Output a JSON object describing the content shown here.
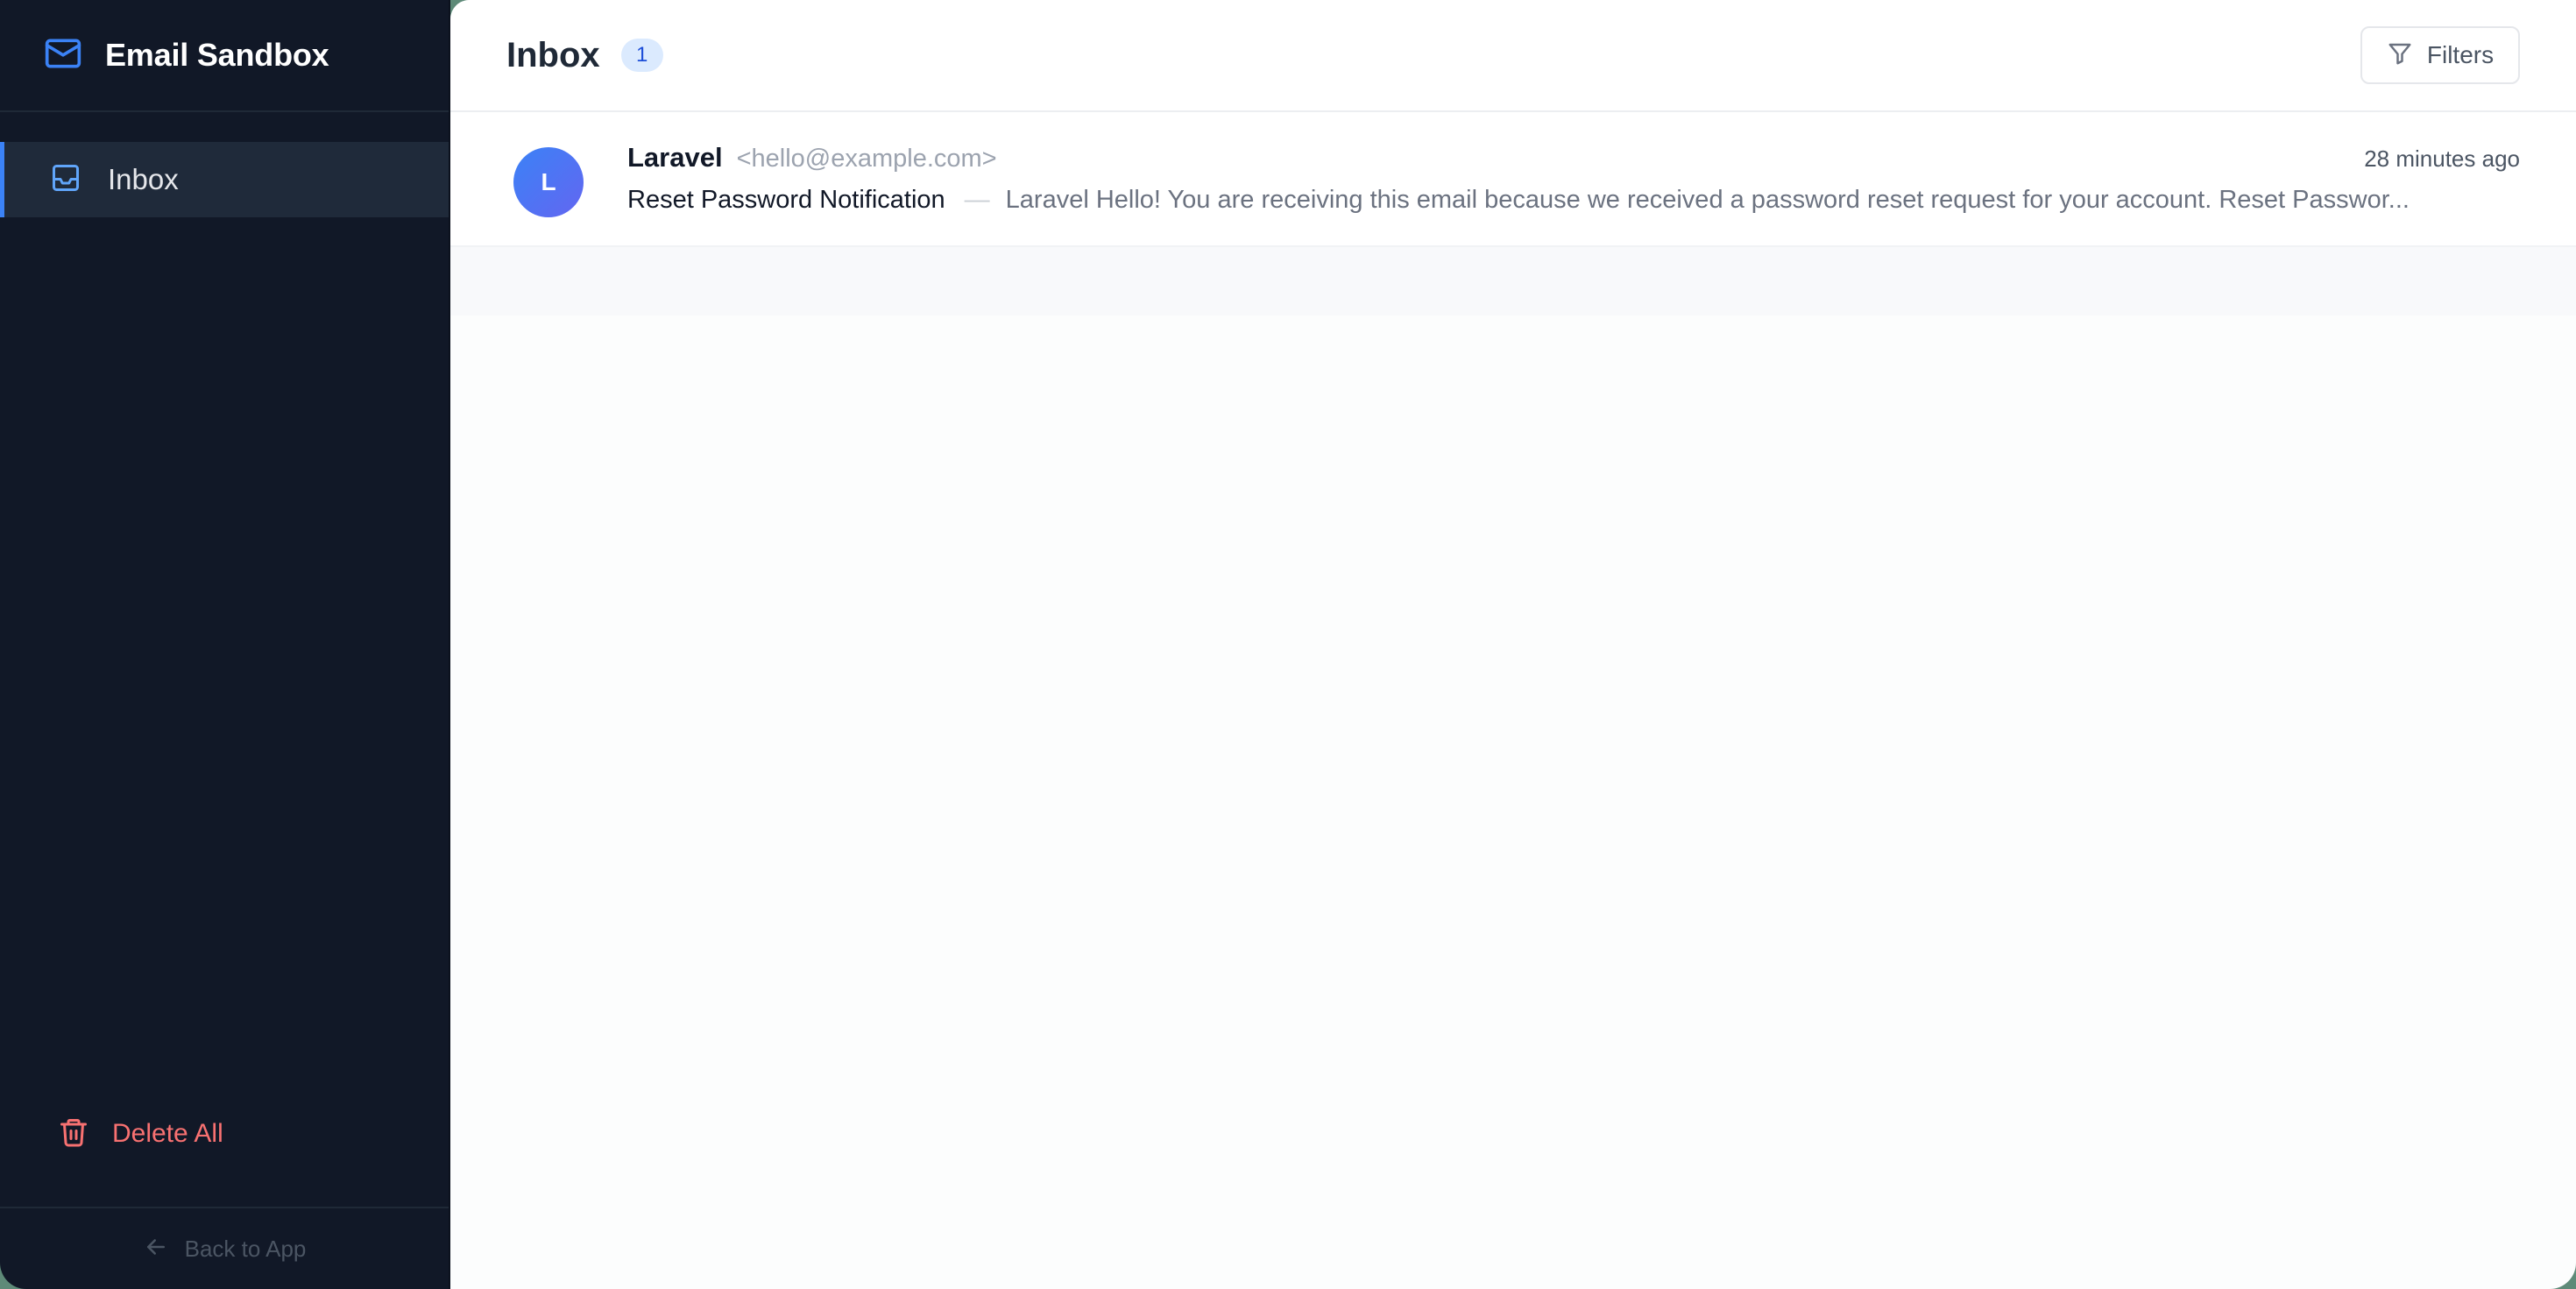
{
  "app": {
    "title": "Email Sandbox"
  },
  "sidebar": {
    "items": [
      {
        "label": "Inbox",
        "icon": "inbox-icon",
        "active": true
      }
    ],
    "delete_all_label": "Delete All",
    "back_label": "Back to App"
  },
  "header": {
    "title": "Inbox",
    "count": "1",
    "filters_label": "Filters"
  },
  "emails": [
    {
      "avatar_letter": "L",
      "sender_name": "Laravel",
      "sender_email": "<hello@example.com>",
      "time": "28 minutes ago",
      "subject": "Reset Password Notification",
      "separator": "—",
      "preview": "Laravel Hello! You are receiving this email because we received a password reset request for your account. Reset Passwor..."
    }
  ],
  "colors": {
    "sidebar_bg": "#111827",
    "accent": "#3b82f6",
    "danger": "#f87171",
    "badge_bg": "#dbeafe"
  }
}
